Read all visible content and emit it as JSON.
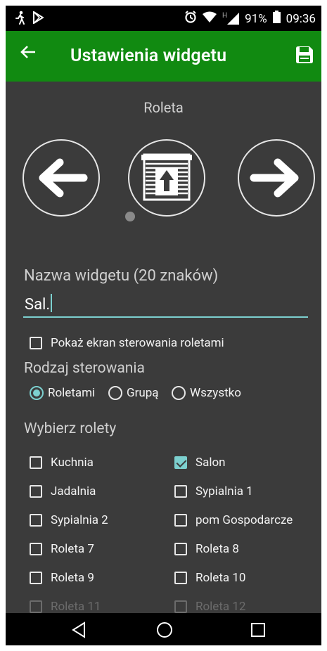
{
  "status_bar": {
    "time": "09:36",
    "battery": "91%",
    "network_type": "H",
    "icons": [
      "walking-person-icon",
      "play-store-icon",
      "alarm-icon",
      "wifi-icon",
      "signal-icon",
      "battery-icon"
    ]
  },
  "app_bar": {
    "title": "Ustawienia widgetu",
    "back_icon": "arrow-back-icon",
    "save_icon": "floppy-save-icon",
    "background": "#118a11"
  },
  "widget_type": {
    "label": "Roleta",
    "prev_icon": "arrow-left-icon",
    "current_icon": "blind-up-icon",
    "next_icon": "arrow-right-icon"
  },
  "name_field": {
    "label": "Nazwa widgetu (20 znaków)",
    "value": "Sal."
  },
  "show_screen": {
    "label": "Pokaż ekran sterowania roletami",
    "checked": false
  },
  "control_type": {
    "label": "Rodzaj sterowania",
    "options": [
      {
        "label": "Roletami",
        "selected": true
      },
      {
        "label": "Grupą",
        "selected": false
      },
      {
        "label": "Wszystko",
        "selected": false
      }
    ]
  },
  "blinds": {
    "label": "Wybierz rolety",
    "items": [
      {
        "label": "Kuchnia",
        "checked": false,
        "enabled": true
      },
      {
        "label": "Salon",
        "checked": true,
        "enabled": true
      },
      {
        "label": "Jadalnia",
        "checked": false,
        "enabled": true
      },
      {
        "label": "Sypialnia 1",
        "checked": false,
        "enabled": true
      },
      {
        "label": "Sypialnia 2",
        "checked": false,
        "enabled": true
      },
      {
        "label": "pom Gospodarcze",
        "checked": false,
        "enabled": true
      },
      {
        "label": "Roleta 7",
        "checked": false,
        "enabled": true
      },
      {
        "label": "Roleta 8",
        "checked": false,
        "enabled": true
      },
      {
        "label": "Roleta 9",
        "checked": false,
        "enabled": true
      },
      {
        "label": "Roleta 10",
        "checked": false,
        "enabled": true
      },
      {
        "label": "Roleta 11",
        "checked": false,
        "enabled": false
      },
      {
        "label": "Roleta 12",
        "checked": false,
        "enabled": false
      }
    ]
  },
  "nav_bar": {
    "icons": [
      "nav-back-icon",
      "nav-home-icon",
      "nav-recents-icon"
    ]
  },
  "colors": {
    "accent": "#7cd0cf",
    "background": "#3b3b3b"
  }
}
